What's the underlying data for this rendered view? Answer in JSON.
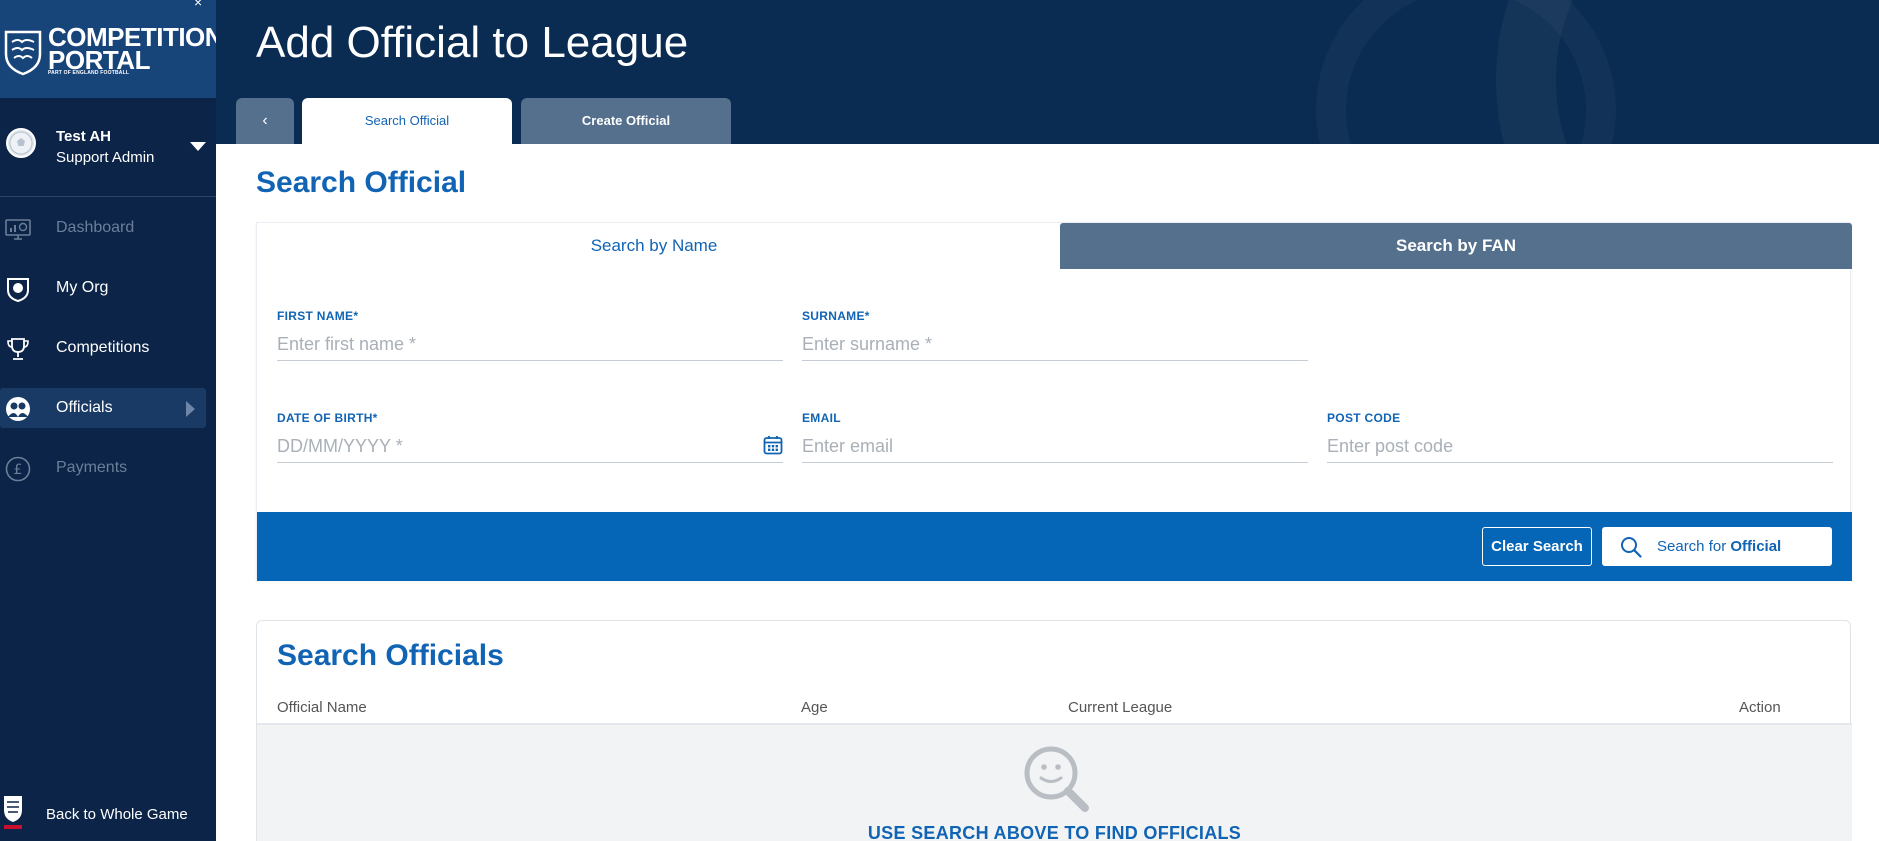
{
  "brand": {
    "title_line1": "COMPETITION",
    "title_line2": "PORTAL",
    "subtitle": "PART OF ENGLAND FOOTBALL",
    "collapse_glyph": "×"
  },
  "user": {
    "name": "Test AH",
    "role": "Support Admin"
  },
  "nav": [
    {
      "label": "Dashboard",
      "icon": "dashboard-icon",
      "disabled": true
    },
    {
      "label": "My Org",
      "icon": "shield-icon",
      "disabled": false
    },
    {
      "label": "Competitions",
      "icon": "trophy-icon",
      "disabled": false
    },
    {
      "label": "Officials",
      "icon": "officials-icon",
      "disabled": false,
      "active": true
    },
    {
      "label": "Payments",
      "icon": "pound-icon",
      "disabled": true
    }
  ],
  "back_link": "Back to Whole Game",
  "header": {
    "title": "Add Official to League",
    "back_glyph": "‹"
  },
  "tabs": {
    "search": "Search Official",
    "create": "Create Official"
  },
  "section_title": "Search Official",
  "subtabs": {
    "by_name": "Search by Name",
    "by_fan": "Search by FAN"
  },
  "fields": {
    "first_name": {
      "label": "FIRST NAME*",
      "placeholder": "Enter first name *"
    },
    "surname": {
      "label": "SURNAME*",
      "placeholder": "Enter surname *"
    },
    "dob": {
      "label": "DATE OF BIRTH*",
      "placeholder": "DD/MM/YYYY *"
    },
    "email": {
      "label": "EMAIL",
      "placeholder": "Enter email"
    },
    "postcode": {
      "label": "POST CODE",
      "placeholder": "Enter post code"
    }
  },
  "actions": {
    "clear": "Clear Search",
    "search_prefix": "Search for ",
    "search_strong": "Official"
  },
  "results": {
    "title": "Search Officials",
    "columns": [
      "Official Name",
      "Age",
      "Current League",
      "Action"
    ],
    "empty_message": "USE SEARCH ABOVE TO FIND OFFICIALS"
  },
  "colors": {
    "sidebar": "#0b2447",
    "brand_bg": "#17457a",
    "header": "#0b2c52",
    "accent": "#1164b4",
    "action_bar": "#0565b6",
    "tab_inactive": "#54708d"
  }
}
